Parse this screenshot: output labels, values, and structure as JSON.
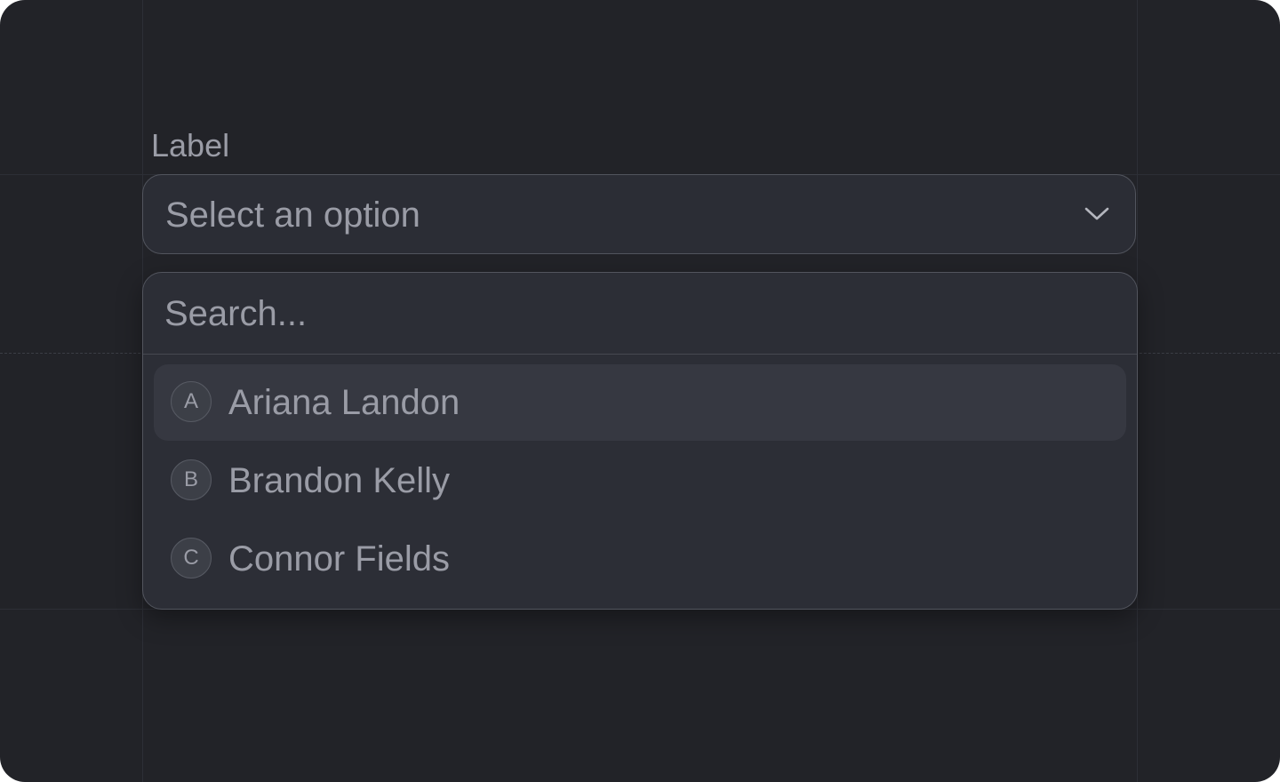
{
  "field": {
    "label": "Label",
    "placeholder": "Select an option",
    "chevron_icon": "chevron-down-icon"
  },
  "dropdown": {
    "search_placeholder": "Search...",
    "options": [
      {
        "initial": "A",
        "label": "Ariana Landon",
        "highlighted": true
      },
      {
        "initial": "B",
        "label": "Brandon Kelly",
        "highlighted": false
      },
      {
        "initial": "C",
        "label": "Connor Fields",
        "highlighted": false
      }
    ]
  },
  "colors": {
    "background": "#222328",
    "surface": "#2c2e36",
    "border": "#52555e",
    "highlight": "#363841",
    "text_muted": "#9a9ca6"
  }
}
